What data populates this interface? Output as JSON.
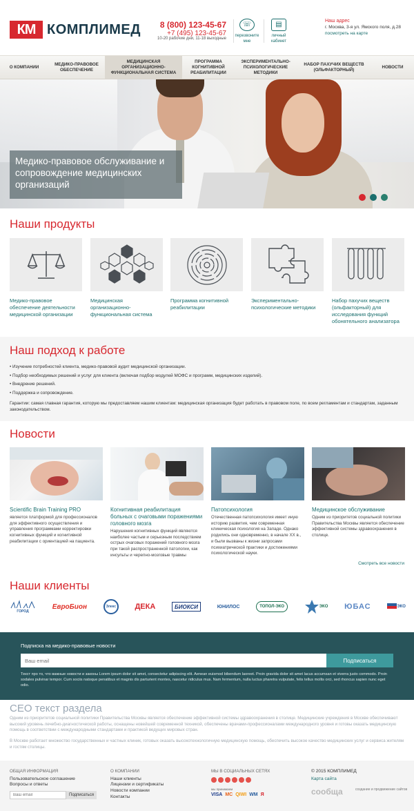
{
  "header": {
    "logo_mark": "КМ",
    "logo_text": "КОМПЛИМЕД",
    "phone1": "8 (800) 123-45-67",
    "phone2": "+7 (495) 123-45-67",
    "hours": "10-20 рабочие дни, 11-18 выходные",
    "callback_label": "перезвоните мне",
    "cabinet_label": "личный кабинет",
    "address_title": "Наш адрес",
    "address": "г. Москва, 3-я ул. Ямского поля, д.28",
    "map_link": "посмотреть на карте"
  },
  "nav": {
    "items": [
      {
        "label": "О компании"
      },
      {
        "label": "Медико-правовое обеспечение"
      },
      {
        "label": "Медицинская организационно-функциональная система"
      },
      {
        "label": "Программа когнитивной реабилитации"
      },
      {
        "label": "Экспериментально-психологические методики"
      },
      {
        "label": "Набор пахучих веществ (ольфакторный)"
      },
      {
        "label": "Новости"
      }
    ]
  },
  "hero": {
    "caption": "Медико-правовое обслуживание и сопровождение медицинских организаций",
    "colors": {
      "dot1": "#d7282f",
      "dot2": "#1a6e6d",
      "dot3": "#2a7f6e"
    }
  },
  "products": {
    "title": "Наши продукты",
    "items": [
      {
        "label": "Медико-правовое обеспечение деятельности медицинской организации",
        "icon": "scales-icon"
      },
      {
        "label": "Медицинская организационно-функциональная система",
        "icon": "hexagon-network-icon"
      },
      {
        "label": "Программа когнитивной реабилитации",
        "icon": "brain-maze-icon"
      },
      {
        "label": "Экспериментально-психологические методики",
        "icon": "puzzle-icon"
      },
      {
        "label": "Набор пахучих веществ (ольфакторный) для исследования функций обонятельного анализатора",
        "icon": "test-tubes-icon"
      }
    ]
  },
  "approach": {
    "title": "Наш подход к работе",
    "items": [
      "Изучение потребностей клиента, медико-правовой аудит медицинской организации.",
      "Подбор необходимых решений и услуг для клиента (включая подбор модулей МОФС и программ, медицинских изделий).",
      "Внедрение решений.",
      "Поддержка и сопровождение."
    ],
    "guarantee": "Гарантии: самая главная гарантия, которую мы предоставляем нашим клиентам: медицинская организация будет работать в правовом поле, по всем регламентам и стандартам, заданным законодательством."
  },
  "news": {
    "title": "Новости",
    "items": [
      {
        "title": "Scientific Brain Training PRO",
        "text": "является платформой для профессионалов для эффективного осуществления и управления программами корректировки когнитивных функций и когнитивной реабилитации с ориентацией на пациента."
      },
      {
        "title": "Когнитивная реабилитация больных с очаговыми поражениями головного мозга",
        "text": "Нарушения когнитивных функций являются наиболее частым и серьезным последствием острых очаговых поражений головного мозга при такой распространенной патологии, как инсульты и черепно-мозговые травмы"
      },
      {
        "title": "Патопсихология",
        "text": "Отечественная патопсихология имеет иную историю развития, чем современная клиническая психология на Западе. Однако родились они одновременно, в начале XX в., и были вызваны к жизни запросами психиатрической практики и достижениями психологической науки."
      },
      {
        "title": "Медицинское обслуживание",
        "text": "Одним из приоритетов социальной политики Правительства Москвы является обеспечение эффективной системы здравоохранения в столице."
      }
    ],
    "all_link": "Смотреть все новости"
  },
  "clients": {
    "title": "Наши клиенты",
    "items": [
      "ГОРОД",
      "ЕвроБион",
      "Элекс",
      "ДЕКА",
      "БИОКСИ",
      "ЮНИЛОС",
      "ТОПОЛ-ЭКО",
      "ЭКО",
      "ЮБАС",
      "ЭКО"
    ]
  },
  "subscribe": {
    "title": "Подписка на медико-правовые новости",
    "placeholder": "Ваш email",
    "button": "Подписаться",
    "text": "Текст про то, что важные новости и законы Lorem ipsum dolor sit amet, consectetur adipiscing elit. Aenean euismod bibendum laoreet. Proin gravida dolor sit amet lacus accumsan et viverra justo commodo. Proin sodales pulvinar tempor. Cum sociis natoque penatibus et magnis dis parturient montes, nascetur ridiculus mus. Nam fermentum, nulla luctus pharetra vulputate, felis tellus mollis orci, sed rhoncus sapien nunc eget odio."
  },
  "seo": {
    "title": "СЕО текст раздела",
    "p1": "Одним из приоритетов социальной политики Правительства Москвы является обеспечение эффективной системы здравоохранения в столице. Медицинские учреждения в Москве обеспечивают высокий уровень лечебно-диагностической работы, оснащены новейшей современной техникой, обеспечены врачами-профессионалами международного уровня и готовы оказать медицинскую помощь в соответствии с международными стандартами и практикой ведущих мировых стран.",
    "p2": "В Москве работает множество государственных и частных клиник, готовых оказать высокотехнологичную медицинскую помощь, обеспечить высокое качество медицинских услуг и сервиса жителям и гостям столицы."
  },
  "footer": {
    "col1": {
      "title": "Общая информация",
      "links": [
        "Пользовательское соглашение",
        "Вопросы и ответы"
      ]
    },
    "email_placeholder": "Ваш email",
    "email_button": "Подписаться",
    "col2": {
      "title": "О компании",
      "links": [
        "Наши клиенты",
        "Лицензии и сертификаты",
        "Новости компании",
        "Контакты"
      ]
    },
    "col3": {
      "title": "Мы в социальных сетях",
      "pay_label": "мы принимаем",
      "pay": [
        "VISA",
        "МС",
        "QIWI",
        "WM",
        "Я"
      ]
    },
    "copyright": "© 2015 КОМПЛИМЕД",
    "sitemap": "Карта сайта",
    "dev_logo": "сообща",
    "dev_text": "создание и продвижение сайтов"
  }
}
